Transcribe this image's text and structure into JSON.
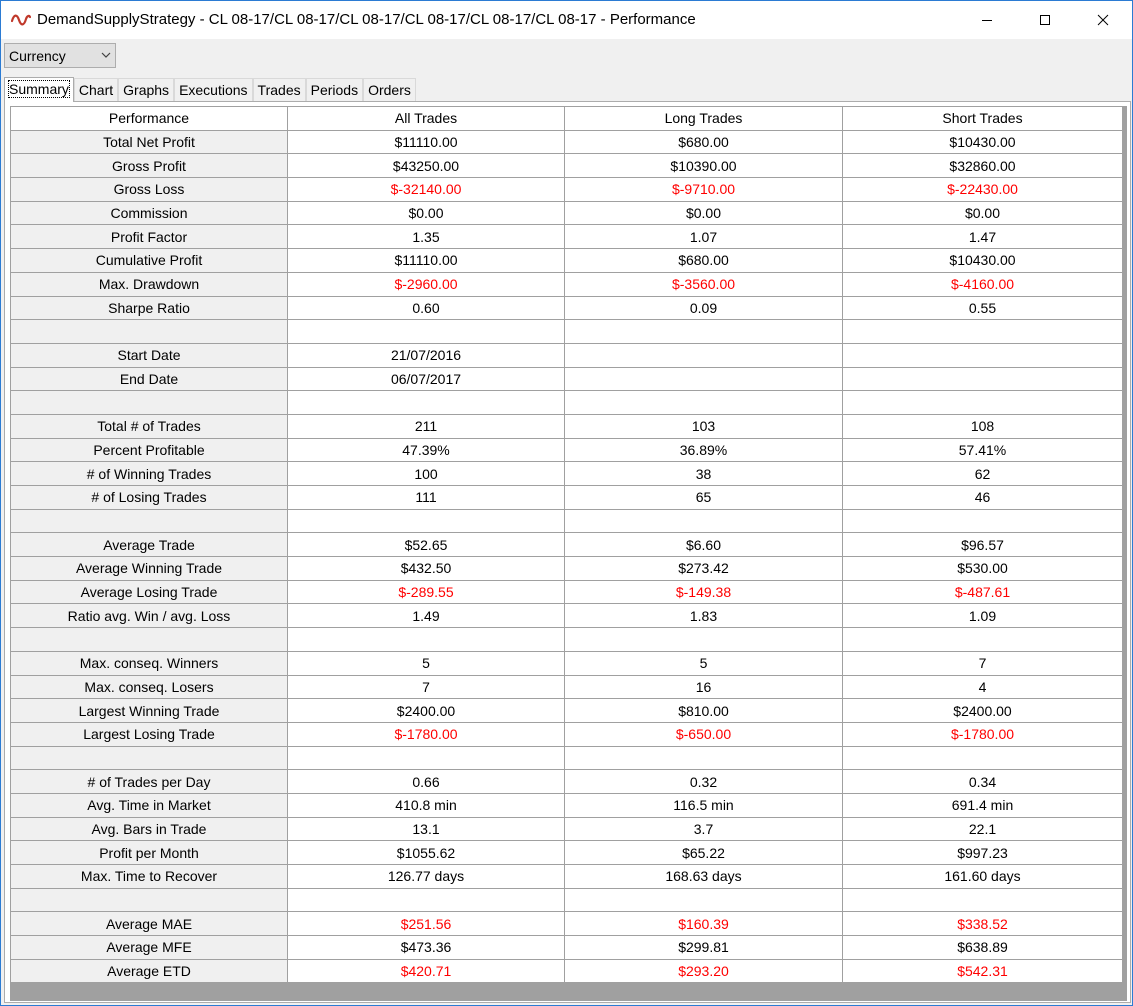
{
  "window": {
    "title": "DemandSupplyStrategy - CL 08-17/CL 08-17/CL 08-17/CL 08-17/CL 08-17/CL 08-17 - Performance",
    "icon": "strategy-wave-icon",
    "controls": [
      "minimize-icon",
      "maximize-icon",
      "close-icon"
    ]
  },
  "display_mode": {
    "selected": "Currency"
  },
  "tabs": [
    {
      "label": "Summary",
      "active": true
    },
    {
      "label": "Chart"
    },
    {
      "label": "Graphs"
    },
    {
      "label": "Executions"
    },
    {
      "label": "Trades"
    },
    {
      "label": "Periods"
    },
    {
      "label": "Orders"
    }
  ],
  "colors": {
    "negative": "#ff0000",
    "header_bg": "#f0f0f0",
    "grid_line": "#a0a0a0"
  },
  "table": {
    "columns": [
      "Performance",
      "All Trades",
      "Long Trades",
      "Short Trades"
    ],
    "rows": [
      {
        "label": "Total Net Profit",
        "values": [
          "$11110.00",
          "$680.00",
          "$10430.00"
        ]
      },
      {
        "label": "Gross Profit",
        "values": [
          "$43250.00",
          "$10390.00",
          "$32860.00"
        ]
      },
      {
        "label": "Gross Loss",
        "values": [
          "$-32140.00",
          "$-9710.00",
          "$-22430.00"
        ],
        "negative": true
      },
      {
        "label": "Commission",
        "values": [
          "$0.00",
          "$0.00",
          "$0.00"
        ]
      },
      {
        "label": "Profit Factor",
        "values": [
          "1.35",
          "1.07",
          "1.47"
        ]
      },
      {
        "label": "Cumulative Profit",
        "values": [
          "$11110.00",
          "$680.00",
          "$10430.00"
        ]
      },
      {
        "label": "Max. Drawdown",
        "values": [
          "$-2960.00",
          "$-3560.00",
          "$-4160.00"
        ],
        "negative": true
      },
      {
        "label": "Sharpe Ratio",
        "values": [
          "0.60",
          "0.09",
          "0.55"
        ]
      },
      {
        "label": "",
        "values": [
          "",
          "",
          ""
        ]
      },
      {
        "label": "Start Date",
        "values": [
          "21/07/2016",
          "",
          ""
        ]
      },
      {
        "label": "End Date",
        "values": [
          "06/07/2017",
          "",
          ""
        ]
      },
      {
        "label": "",
        "values": [
          "",
          "",
          ""
        ]
      },
      {
        "label": "Total # of Trades",
        "values": [
          "211",
          "103",
          "108"
        ]
      },
      {
        "label": "Percent Profitable",
        "values": [
          "47.39%",
          "36.89%",
          "57.41%"
        ]
      },
      {
        "label": "# of Winning Trades",
        "values": [
          "100",
          "38",
          "62"
        ]
      },
      {
        "label": "# of Losing Trades",
        "values": [
          "111",
          "65",
          "46"
        ]
      },
      {
        "label": "",
        "values": [
          "",
          "",
          ""
        ]
      },
      {
        "label": "Average Trade",
        "values": [
          "$52.65",
          "$6.60",
          "$96.57"
        ]
      },
      {
        "label": "Average Winning Trade",
        "values": [
          "$432.50",
          "$273.42",
          "$530.00"
        ]
      },
      {
        "label": "Average Losing Trade",
        "values": [
          "$-289.55",
          "$-149.38",
          "$-487.61"
        ],
        "negative": true
      },
      {
        "label": "Ratio avg. Win / avg. Loss",
        "values": [
          "1.49",
          "1.83",
          "1.09"
        ]
      },
      {
        "label": "",
        "values": [
          "",
          "",
          ""
        ]
      },
      {
        "label": "Max. conseq. Winners",
        "values": [
          "5",
          "5",
          "7"
        ]
      },
      {
        "label": "Max. conseq. Losers",
        "values": [
          "7",
          "16",
          "4"
        ]
      },
      {
        "label": "Largest Winning Trade",
        "values": [
          "$2400.00",
          "$810.00",
          "$2400.00"
        ]
      },
      {
        "label": "Largest Losing Trade",
        "values": [
          "$-1780.00",
          "$-650.00",
          "$-1780.00"
        ],
        "negative": true
      },
      {
        "label": "",
        "values": [
          "",
          "",
          ""
        ]
      },
      {
        "label": "# of Trades per Day",
        "values": [
          "0.66",
          "0.32",
          "0.34"
        ]
      },
      {
        "label": "Avg. Time in Market",
        "values": [
          "410.8 min",
          "116.5 min",
          "691.4 min"
        ]
      },
      {
        "label": "Avg. Bars in Trade",
        "values": [
          "13.1",
          "3.7",
          "22.1"
        ]
      },
      {
        "label": "Profit per Month",
        "values": [
          "$1055.62",
          "$65.22",
          "$997.23"
        ]
      },
      {
        "label": "Max. Time to Recover",
        "values": [
          "126.77 days",
          "168.63 days",
          "161.60 days"
        ]
      },
      {
        "label": "",
        "values": [
          "",
          "",
          ""
        ]
      },
      {
        "label": "Average MAE",
        "values": [
          "$251.56",
          "$160.39",
          "$338.52"
        ],
        "negative": true
      },
      {
        "label": "Average MFE",
        "values": [
          "$473.36",
          "$299.81",
          "$638.89"
        ]
      },
      {
        "label": "Average ETD",
        "values": [
          "$420.71",
          "$293.20",
          "$542.31"
        ],
        "negative": true
      }
    ]
  }
}
